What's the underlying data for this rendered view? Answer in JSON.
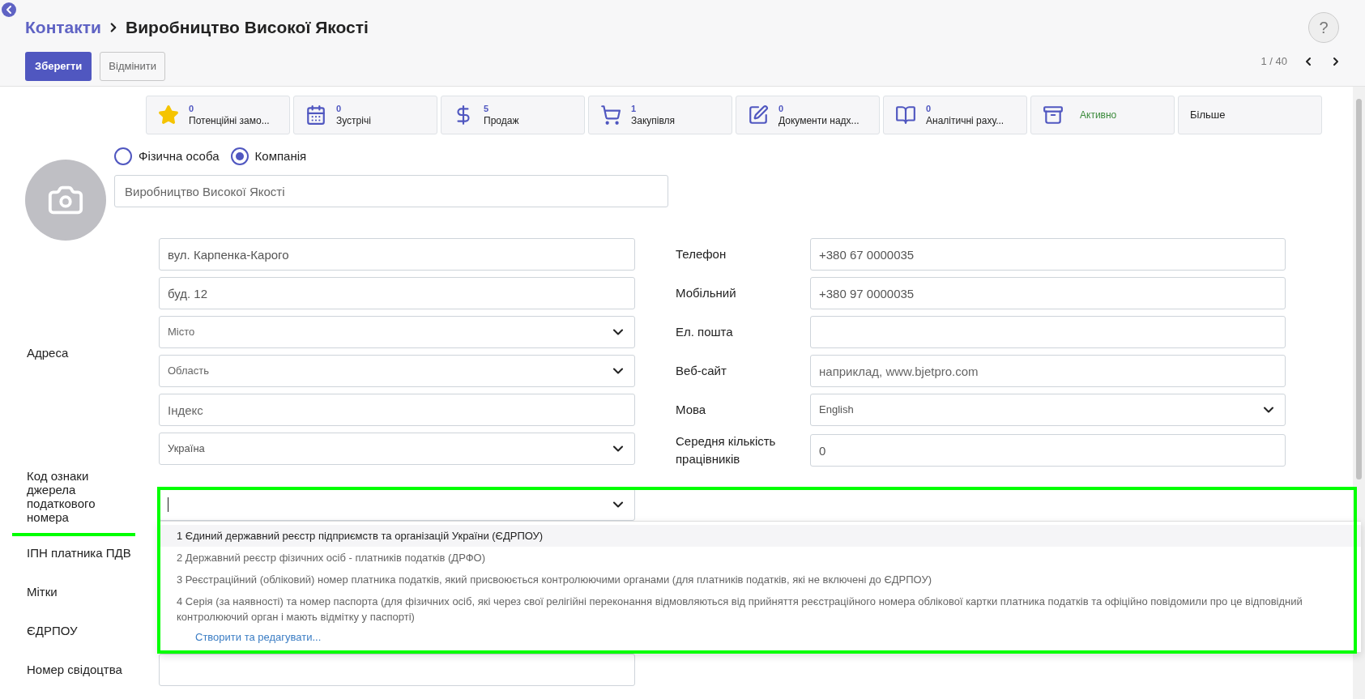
{
  "header": {
    "breadcrumb_parent": "Контакти",
    "title": "Виробництво Високої Якості",
    "buttons": [
      {
        "label": "Зберегти",
        "kind": "primary"
      },
      {
        "label": "Відмінити",
        "kind": "secondary"
      }
    ],
    "pager": "1 / 40",
    "help": "?"
  },
  "smart_buttons": [
    {
      "kind": "stat",
      "count": "0",
      "label": "Потенційні замо..."
    },
    {
      "kind": "stat",
      "count": "0",
      "label": "Зустрічі"
    },
    {
      "kind": "stat",
      "count": "5",
      "label": "Продаж"
    },
    {
      "kind": "stat",
      "count": "1",
      "label": "Закупівля"
    },
    {
      "kind": "stat",
      "count": "0",
      "label": "Документи надх..."
    },
    {
      "kind": "stat",
      "count": "0",
      "label": "Аналітичні раху..."
    },
    {
      "kind": "toggle",
      "label": "Активно"
    },
    {
      "kind": "more",
      "label": "Більше"
    }
  ],
  "company_type": [
    {
      "label": "Фізична особа",
      "selected": false
    },
    {
      "label": "Компанія",
      "selected": true
    }
  ],
  "name_field": {
    "value": "Виробництво Високої Якості"
  },
  "address": {
    "label": "Адреса",
    "fields": [
      {
        "kind": "text",
        "value": "вул. Карпенка-Карого"
      },
      {
        "kind": "text",
        "value": "буд. 12"
      },
      {
        "kind": "select",
        "placeholder": "Місто"
      },
      {
        "kind": "select",
        "placeholder": "Область"
      },
      {
        "kind": "text",
        "placeholder": "Індекс"
      },
      {
        "kind": "select",
        "value": "Україна"
      }
    ]
  },
  "contact_fields": [
    {
      "label": "Телефон",
      "kind": "text",
      "value": "+380 67 0000035"
    },
    {
      "label": "Мобільний",
      "kind": "text",
      "value": "+380 97 0000035"
    },
    {
      "label": "Ел. пошта",
      "kind": "text"
    },
    {
      "label": "Веб-сайт",
      "kind": "text",
      "placeholder": "наприклад, www.bjetpro.com"
    },
    {
      "label": "Мова",
      "kind": "select",
      "value": "English"
    },
    {
      "label": "Середня кількість працівників",
      "kind": "text",
      "value": "0"
    }
  ],
  "tax_source": {
    "label": "Код ознаки джерела податкового номера",
    "options": [
      {
        "label": "1 Єдиний державний реєстр підприємств та організацій України (ЄДРПОУ)",
        "selected": true
      },
      {
        "label": "2 Державний реєстр фізичних осіб - платників податків (ДРФО)",
        "selected": false
      },
      {
        "label": "3 Реєстраційний (обліковий) номер платника податків, який присвоюється контролюючими органами (для платників податків, які не включені до ЄДРПОУ)",
        "selected": false
      },
      {
        "label": "4 Серія (за наявності) та номер паспорта (для фізичних осіб, які через свої релігійні переконання відмовляються від прийняття реєстраційного номера облікової картки платника податків та офіційно повідомили про це відповідний контролюючий орган і мають відмітку у паспорті)",
        "selected": false
      }
    ],
    "create_link": "Створити та редагувати..."
  },
  "other_fields": [
    {
      "label": "ІПН платника ПДВ"
    },
    {
      "label": "Мітки"
    },
    {
      "label": "ЄДРПОУ"
    },
    {
      "label": "Номер свідоцтва"
    }
  ]
}
